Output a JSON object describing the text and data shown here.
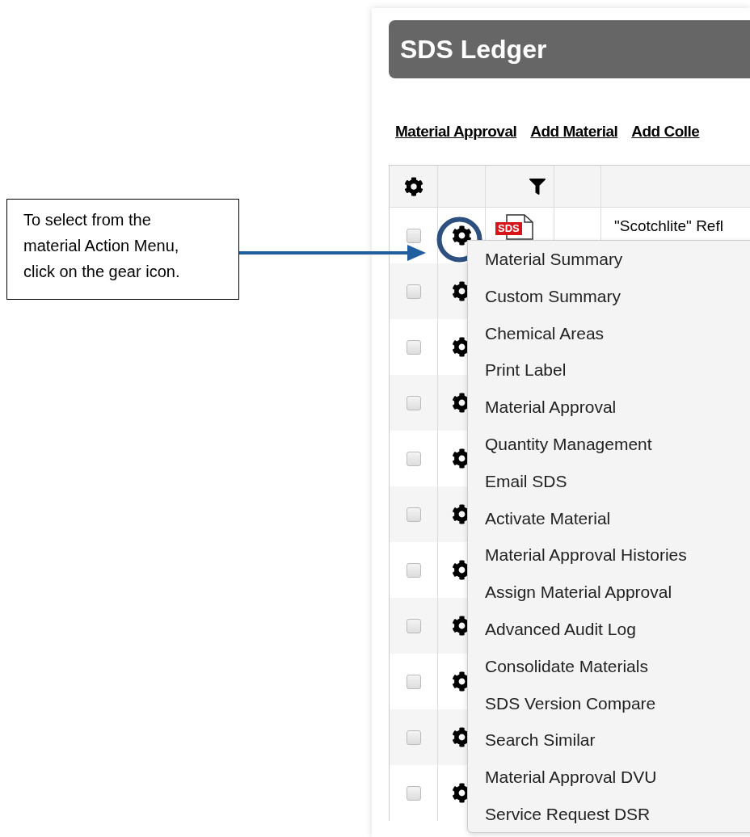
{
  "callout": {
    "text": "To select from the material Action Menu, click on the gear icon."
  },
  "ledger": {
    "title": "SDS Ledger",
    "links": [
      "Material Approval",
      "Add Material",
      "Add Colle"
    ],
    "rows": [
      {
        "checked": false,
        "sds": "SDS",
        "name": "\"Scotchlite\" Refl"
      },
      {
        "checked": false
      },
      {
        "checked": false
      },
      {
        "checked": false
      },
      {
        "checked": false
      },
      {
        "checked": false
      },
      {
        "checked": false
      },
      {
        "checked": false
      },
      {
        "checked": false
      },
      {
        "checked": false
      },
      {
        "checked": false
      }
    ]
  },
  "action_menu": {
    "items": [
      "Material Summary",
      "Custom Summary",
      "Chemical Areas",
      "Print Label",
      "Material Approval",
      "Quantity Management",
      "Email SDS",
      "Activate Material",
      "Material Approval Histories",
      "Assign Material Approval",
      "Advanced Audit Log",
      "Consolidate Materials",
      "SDS Version Compare",
      "Search Similar",
      "Material Approval DVU",
      "Service Request DSR"
    ]
  }
}
